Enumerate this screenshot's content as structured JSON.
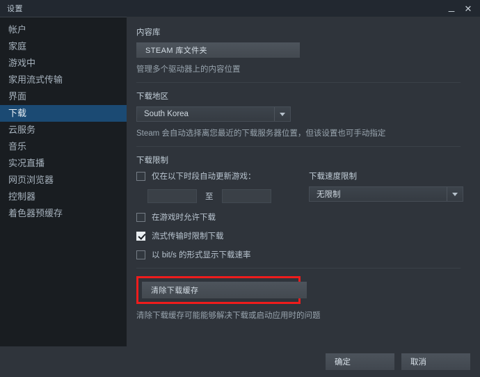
{
  "window": {
    "title": "设置",
    "minimize_icon": "minimize-icon",
    "close_icon": "close-icon",
    "minimize_glyph": "_",
    "close_glyph": "✕"
  },
  "sidebar": {
    "items": [
      {
        "label": "帐户",
        "selected": false
      },
      {
        "label": "家庭",
        "selected": false
      },
      {
        "label": "游戏中",
        "selected": false
      },
      {
        "label": "家用流式传输",
        "selected": false
      },
      {
        "label": "界面",
        "selected": false
      },
      {
        "label": "下载",
        "selected": true
      },
      {
        "label": "云服务",
        "selected": false
      },
      {
        "label": "音乐",
        "selected": false
      },
      {
        "label": "实况直播",
        "selected": false
      },
      {
        "label": "网页浏览器",
        "selected": false
      },
      {
        "label": "控制器",
        "selected": false
      },
      {
        "label": "着色器预缓存",
        "selected": false
      }
    ]
  },
  "content": {
    "content_library": {
      "section_label": "内容库",
      "button_label": "STEAM 库文件夹",
      "hint": "管理多个驱动器上的内容位置"
    },
    "download_region": {
      "section_label": "下载地区",
      "selected_value": "South Korea",
      "hint": "Steam 会自动选择离您最近的下载服务器位置，但该设置也可手动指定"
    },
    "download_limits": {
      "section_label": "下载限制",
      "auto_update_checkbox": {
        "label": "仅在以下时段自动更新游戏：",
        "checked": false
      },
      "time_from": "",
      "time_to": "",
      "time_separator": "至",
      "allow_while_playing": {
        "label": "在游戏时允许下载",
        "checked": false
      },
      "throttle_while_streaming": {
        "label": "流式传输时限制下载",
        "checked": true
      },
      "show_bits": {
        "label": "以 bit/s 的形式显示下载速率",
        "checked": false
      },
      "speed_limit_label": "下载速度限制",
      "speed_limit_value": "无限制"
    },
    "clear_cache": {
      "button_label": "清除下载缓存",
      "hint": "清除下载缓存可能能够解决下载或启动应用时的问题",
      "highlight_color": "#ee1c1c"
    }
  },
  "footer": {
    "ok_label": "确定",
    "cancel_label": "取消"
  }
}
